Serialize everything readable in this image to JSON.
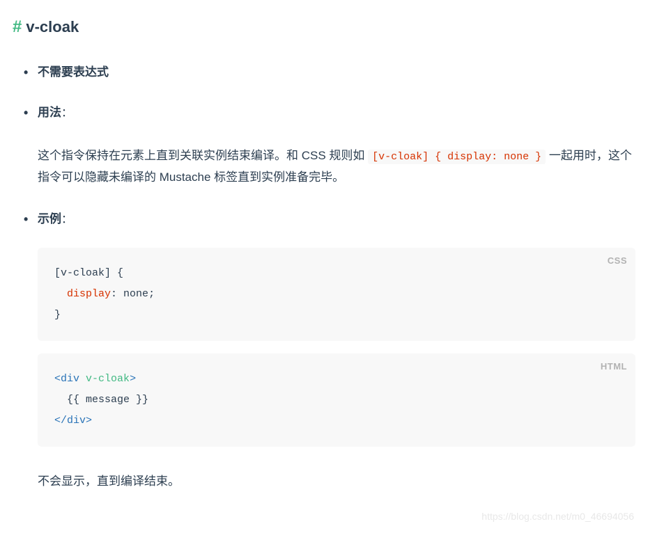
{
  "heading": {
    "hash": "#",
    "title": "v-cloak"
  },
  "items": {
    "no_expr": {
      "title": "不需要表达式"
    },
    "usage": {
      "title": "用法",
      "colon": "：",
      "desc_part1": "这个指令保持在元素上直到关联实例结束编译。和 CSS 规则如 ",
      "inline_code": "[v-cloak] { display: none }",
      "desc_part2": " 一起用时，这个指令可以隐藏未编译的 Mustache 标签直到实例准备完毕。"
    },
    "example": {
      "title": "示例",
      "colon": "：",
      "css_block": {
        "lang_label": "CSS",
        "line1_selector": "[v-cloak]",
        "line1_brace": " {",
        "line2_indent": "  ",
        "line2_prop": "display",
        "line2_sep": ": ",
        "line2_val": "none",
        "line2_semi": ";",
        "line3": "}"
      },
      "html_block": {
        "lang_label": "HTML",
        "line1_open": "<",
        "line1_tag": "div",
        "line1_space": " ",
        "line1_attr": "v-cloak",
        "line1_close": ">",
        "line2_indent": "  ",
        "line2_text": "{{ message }}",
        "line3_open": "</",
        "line3_tag": "div",
        "line3_close": ">"
      },
      "end_text": "不会显示，直到编译结束。"
    }
  },
  "watermark": "https://blog.csdn.net/m0_46694056"
}
